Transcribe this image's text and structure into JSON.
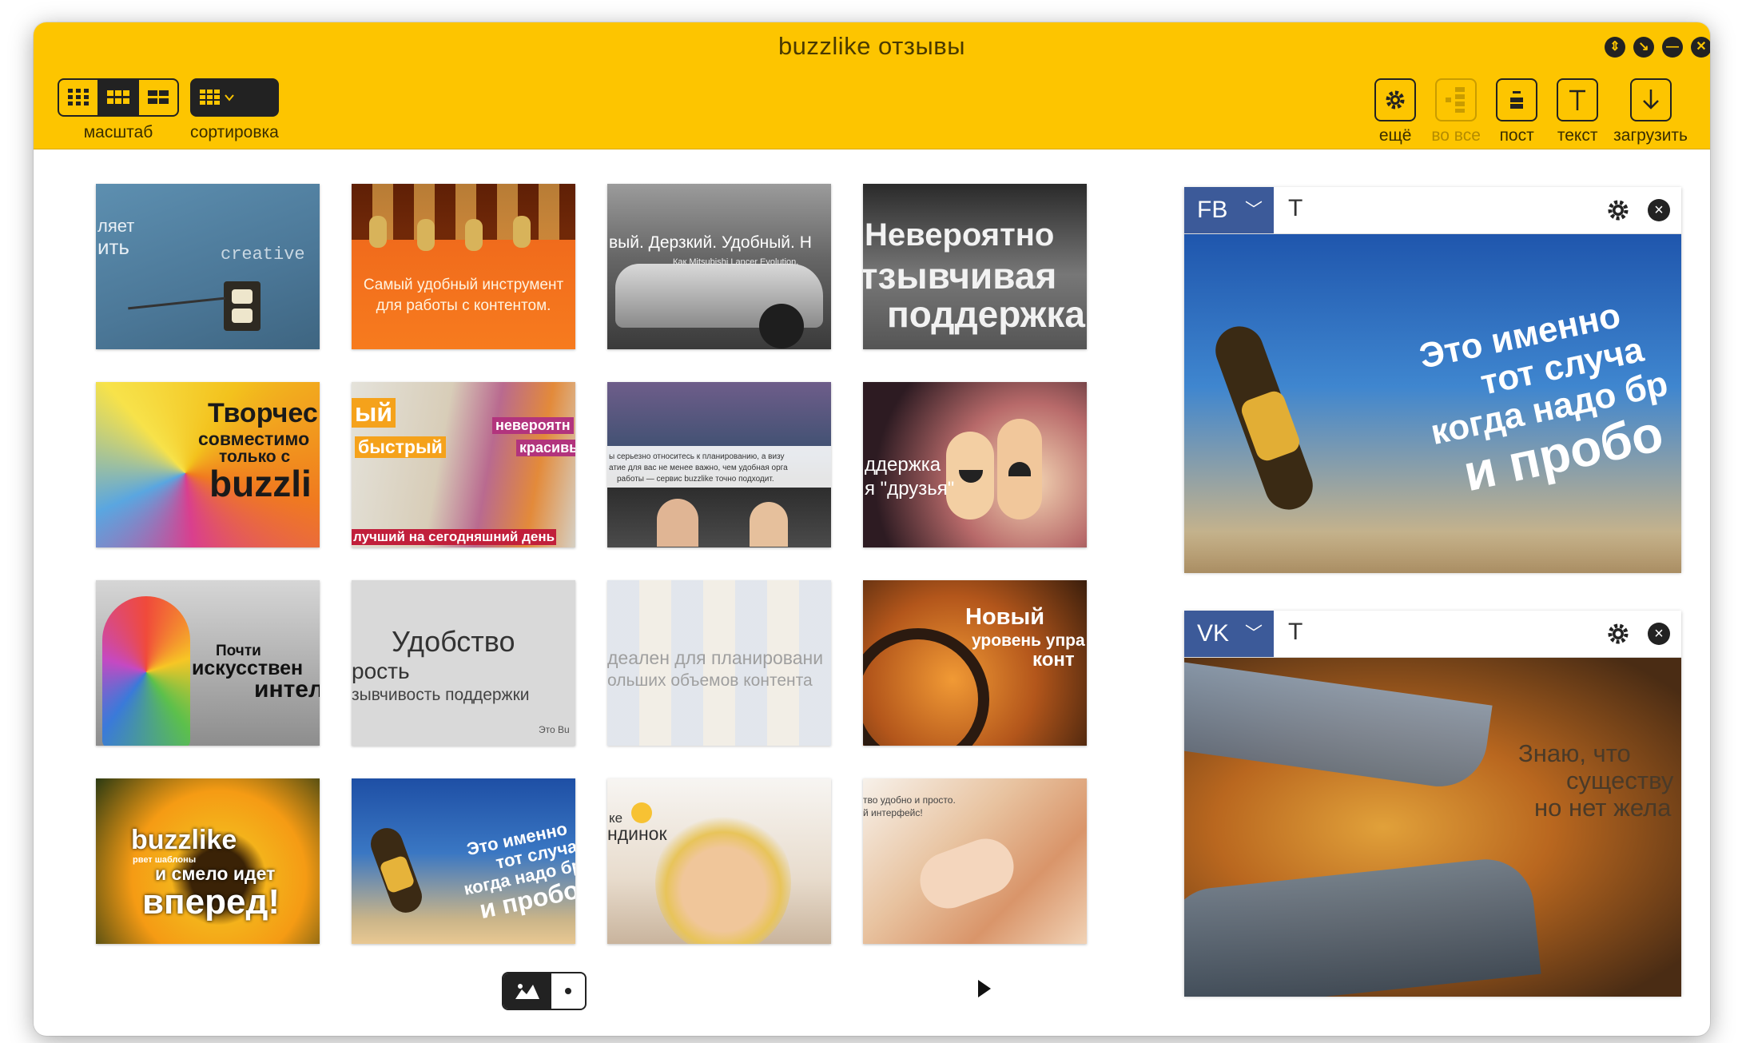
{
  "window": {
    "title": "buzzlike отзывы"
  },
  "toolbar": {
    "scale_label": "масштаб",
    "sort_label": "сортировка",
    "more_label": "ещё",
    "to_all_label": "во все",
    "post_label": "пост",
    "text_label": "текст",
    "upload_label": "загрузить"
  },
  "tiles": [
    {
      "caption_lines": [
        "ляет",
        "ить"
      ],
      "extra": "creative"
    },
    {
      "caption_lines": [
        "Самый удобный инструмент",
        "для работы с контентом."
      ]
    },
    {
      "caption_lines": [
        "вый. Дерзкий. Удобный. Н"
      ],
      "sub": "Как Mitsubishi Lancer Evolution."
    },
    {
      "caption_lines": [
        "Невероятно",
        "тзывчивая",
        "поддержка"
      ]
    },
    {
      "caption_lines": [
        "Творчес",
        "совместимо",
        "только с",
        "buzzli"
      ]
    },
    {
      "caption_lines": [
        "ый",
        "быстрый",
        "невероятн",
        "красивы",
        "лучший на сегодняшний день"
      ]
    },
    {
      "caption_lines": [
        "ы серьезно относитесь к планированию, а визу",
        "атие для вас не менее важно, чем удобная орга",
        "работы — сервис buzzlike точно подходит."
      ]
    },
    {
      "caption_lines": [
        "ддержка",
        "я \"друзья\""
      ]
    },
    {
      "caption_lines": [
        "Почти",
        "искусствен",
        "интел"
      ]
    },
    {
      "caption_lines": [
        "Удобство",
        "рость",
        "зывчивость поддержки",
        "Это Bu"
      ]
    },
    {
      "caption_lines": [
        "деален для планировани",
        "ольших объемов контента"
      ]
    },
    {
      "caption_lines": [
        "Новый",
        "уровень упра",
        "конт"
      ]
    },
    {
      "caption_lines": [
        "buzzlike",
        "рвет шаблоны",
        "и смело идет",
        "вперед!"
      ]
    },
    {
      "caption_lines": [
        "Это именно",
        "тот случа",
        "когда надо бр",
        "и пробо"
      ]
    },
    {
      "caption_lines": [
        "ке",
        "ндинок"
      ]
    },
    {
      "caption_lines": [
        "тво удобно и просто.",
        "й интерфейс!"
      ]
    }
  ],
  "panels": [
    {
      "network": "FB",
      "text_icon": "T",
      "caption_lines": [
        "Это именно",
        "тот случа",
        "когда надо бр",
        "и пробо"
      ]
    },
    {
      "network": "VK",
      "text_icon": "T",
      "caption_lines": [
        "Знаю, что",
        "существу",
        "но нет жела"
      ]
    }
  ],
  "colors": {
    "accent": "#fdc500",
    "fb": "#3c5a99",
    "dark": "#222222"
  }
}
